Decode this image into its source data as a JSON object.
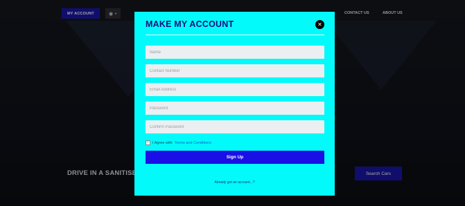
{
  "nav": {
    "my_account": "MY ACCOUNT",
    "user_icon": "user-icon",
    "links": [
      "CONTACT US",
      "ABOUT US"
    ]
  },
  "hero": {
    "text": "DRIVE IN A SANITISED",
    "search_button": "Search Cars"
  },
  "modal": {
    "title": "MAKE MY ACCOUNT",
    "close_icon": "close-icon",
    "fields": {
      "name": "Name",
      "contact": "Contact Number",
      "email": "Email Address",
      "password": "Password",
      "confirm_password": "Confirm Password"
    },
    "agree_text": "I Agree with",
    "terms_link": "Terms and Conditions",
    "signup_button": "Sign Up",
    "login_link": "Already got an account...?"
  },
  "colors": {
    "modal_bg": "#03fafa",
    "primary": "#1a0fe6",
    "nav_button": "#1a16a8",
    "title": "#14117d"
  }
}
